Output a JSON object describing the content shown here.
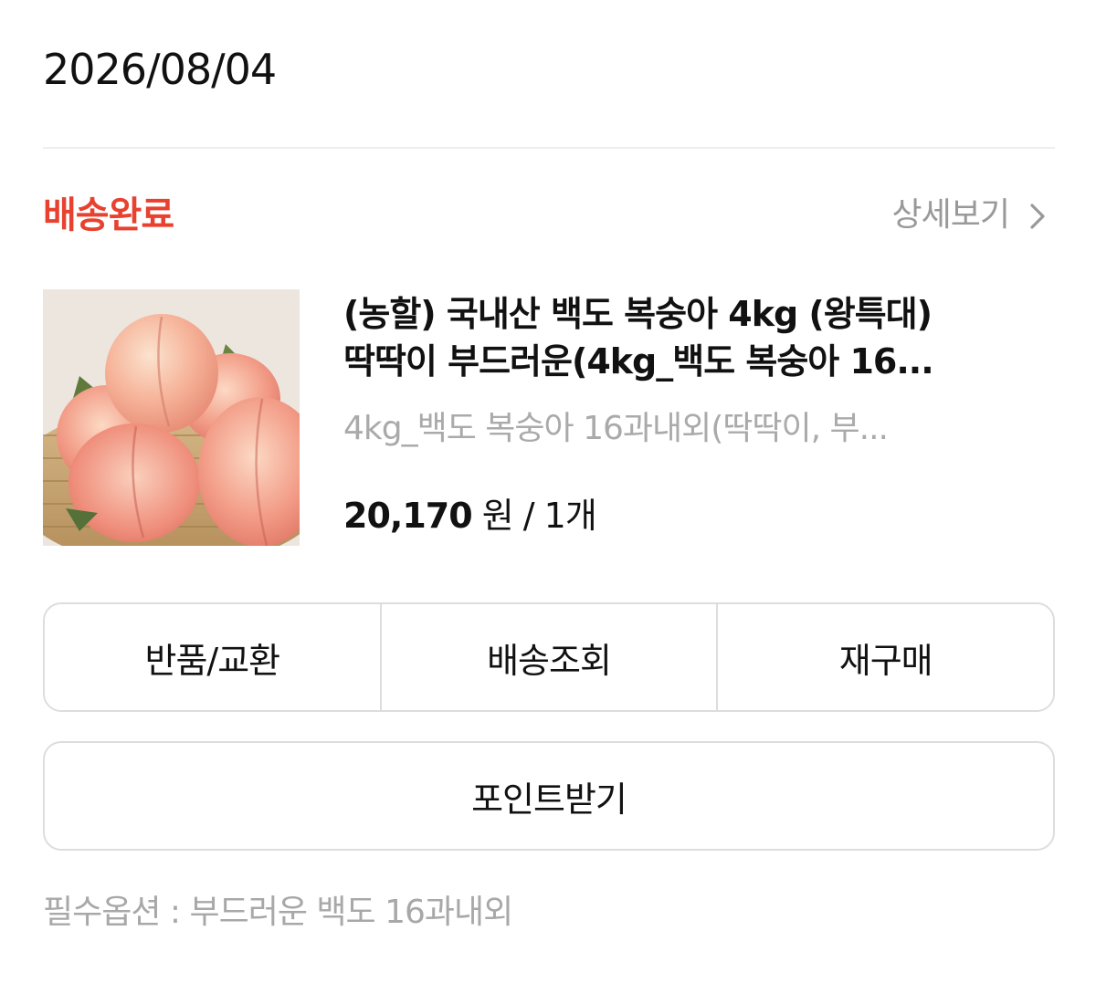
{
  "order": {
    "date": "2026/08/04",
    "status": "배송완료",
    "status_color": "#e8412f",
    "detail_link": "상세보기",
    "detail_icon": "chevron-right-icon"
  },
  "product": {
    "image": "peach-basket-photo",
    "title_line1": "(농할) 국내산 백도 복숭아 4kg (왕특대)",
    "title_line2": "딱딱이 부드러운(4kg_백도 복숭아 16...",
    "option": "4kg_백도 복숭아 16과내외(딱딱이, 부...",
    "price": "20,170",
    "price_unit": "원",
    "quantity": "/ 1개"
  },
  "actions": {
    "return_exchange": "반품/교환",
    "track_delivery": "배송조회",
    "repurchase": "재구매",
    "get_points": "포인트받기"
  },
  "required_option": "필수옵션 : 부드러운 백도 16과내외"
}
